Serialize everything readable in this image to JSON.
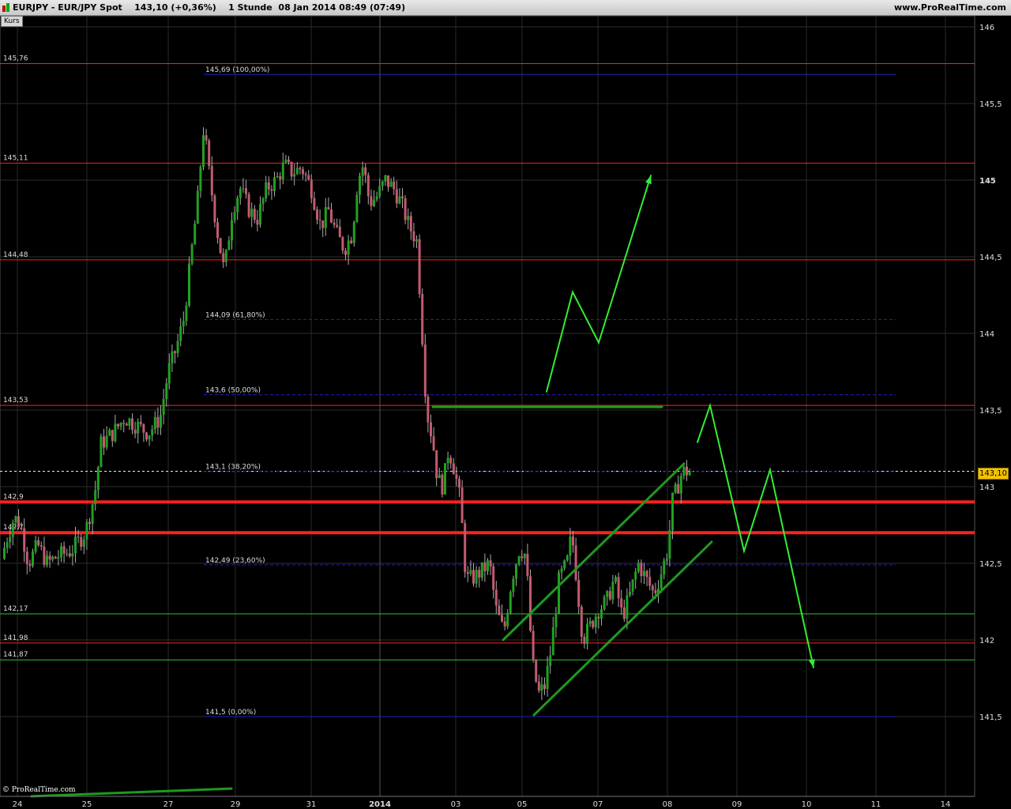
{
  "header": {
    "title": "EURJPY - EUR/JPY Spot    143,10 (+0,36%)    1 Stunde  08 Jan 2014 08:49 (07:49)",
    "site": "www.ProRealTime.com"
  },
  "panel": {
    "tab": "Kurs",
    "watermark": "© ProRealTime.com",
    "last_price": "143,10"
  },
  "colors": {
    "up": "#22a022",
    "down": "#c45a70",
    "wick": "#aaaaaa",
    "support": "#ff2020",
    "green_level": "#2cc52c",
    "fib": "#2020c0",
    "trend": "#1e9a1e",
    "forecast": "#33ee33"
  },
  "chart_data": {
    "type": "candlestick",
    "ylim": [
      141.0,
      146.05
    ],
    "y_ticks": [
      "146",
      "145,5",
      "145",
      "144,5",
      "144",
      "143,5",
      "143",
      "142,5",
      "142",
      "141,5"
    ],
    "x_ticks": [
      "24",
      "25",
      "27",
      "29",
      "31",
      "2014",
      "03",
      "05",
      "07",
      "08",
      "09",
      "10",
      "11",
      "14"
    ],
    "horizontal_levels": [
      {
        "label": "145,76",
        "value": 145.76,
        "style": "red-thin"
      },
      {
        "label": "145,11",
        "value": 145.11,
        "style": "red-thin"
      },
      {
        "label": "144,48",
        "value": 144.48,
        "style": "red-thin"
      },
      {
        "label": "143,53",
        "value": 143.53,
        "style": "red-thin"
      },
      {
        "label": "142,9",
        "value": 142.9,
        "style": "red-thick"
      },
      {
        "label": "142,7",
        "value": 142.7,
        "style": "red-thick"
      },
      {
        "label": "142,17",
        "value": 142.17,
        "style": "green-thin"
      },
      {
        "label": "141,98",
        "value": 141.98,
        "style": "red-thin"
      },
      {
        "label": "141,87",
        "value": 141.87,
        "style": "green-thin"
      }
    ],
    "fibonacci": [
      {
        "label": "145,69 (100,00%)",
        "value": 145.69
      },
      {
        "label": "144,09 (61,80%)",
        "value": 144.09
      },
      {
        "label": "143,6 (50,00%)",
        "value": 143.6
      },
      {
        "label": "143,1 (38,20%)",
        "value": 143.1
      },
      {
        "label": "142,49 (23,60%)",
        "value": 142.49
      },
      {
        "label": "141,5 (0,00%)",
        "value": 141.5
      }
    ],
    "last_price": 143.1,
    "price_path": [
      [
        0,
        142.45
      ],
      [
        10,
        142.65
      ],
      [
        20,
        142.8
      ],
      [
        28,
        142.75
      ],
      [
        38,
        142.5
      ],
      [
        50,
        142.62
      ],
      [
        62,
        142.5
      ],
      [
        76,
        142.55
      ],
      [
        92,
        142.58
      ],
      [
        110,
        142.7
      ],
      [
        122,
        142.95
      ],
      [
        130,
        143.28
      ],
      [
        145,
        143.35
      ],
      [
        160,
        143.45
      ],
      [
        175,
        143.4
      ],
      [
        190,
        143.35
      ],
      [
        205,
        143.45
      ],
      [
        215,
        143.75
      ],
      [
        225,
        143.9
      ],
      [
        235,
        144.1
      ],
      [
        245,
        144.55
      ],
      [
        252,
        144.85
      ],
      [
        260,
        145.35
      ],
      [
        268,
        145.0
      ],
      [
        276,
        144.7
      ],
      [
        286,
        144.4
      ],
      [
        296,
        144.8
      ],
      [
        306,
        144.95
      ],
      [
        318,
        144.8
      ],
      [
        328,
        144.75
      ],
      [
        340,
        144.95
      ],
      [
        352,
        145.0
      ],
      [
        362,
        145.1
      ],
      [
        372,
        145.05
      ],
      [
        384,
        145.08
      ],
      [
        396,
        144.95
      ],
      [
        408,
        144.7
      ],
      [
        418,
        144.8
      ],
      [
        428,
        144.65
      ],
      [
        438,
        144.55
      ],
      [
        448,
        144.65
      ],
      [
        455,
        145.0
      ],
      [
        462,
        145.1
      ],
      [
        470,
        144.85
      ],
      [
        480,
        144.9
      ],
      [
        490,
        145.0
      ],
      [
        500,
        144.95
      ],
      [
        510,
        144.85
      ],
      [
        520,
        144.7
      ],
      [
        530,
        144.6
      ],
      [
        536,
        144.05
      ],
      [
        542,
        143.5
      ],
      [
        550,
        143.3
      ],
      [
        556,
        143.05
      ],
      [
        563,
        143.0
      ],
      [
        570,
        143.25
      ],
      [
        578,
        143.1
      ],
      [
        585,
        142.9
      ],
      [
        592,
        142.4
      ],
      [
        600,
        142.4
      ],
      [
        612,
        142.45
      ],
      [
        622,
        142.5
      ],
      [
        630,
        142.2
      ],
      [
        640,
        142.05
      ],
      [
        650,
        142.4
      ],
      [
        660,
        142.6
      ],
      [
        668,
        142.55
      ],
      [
        676,
        141.85
      ],
      [
        684,
        141.65
      ],
      [
        692,
        141.7
      ],
      [
        700,
        141.95
      ],
      [
        710,
        142.4
      ],
      [
        720,
        142.5
      ],
      [
        726,
        142.7
      ],
      [
        733,
        142.35
      ],
      [
        740,
        142.0
      ],
      [
        750,
        142.1
      ],
      [
        760,
        142.2
      ],
      [
        770,
        142.25
      ],
      [
        780,
        142.4
      ],
      [
        790,
        142.15
      ],
      [
        800,
        142.3
      ],
      [
        810,
        142.5
      ],
      [
        820,
        142.4
      ],
      [
        830,
        142.3
      ],
      [
        840,
        142.45
      ],
      [
        848,
        142.6
      ],
      [
        853,
        142.9
      ],
      [
        860,
        143.0
      ],
      [
        866,
        143.1
      ],
      [
        872,
        143.1
      ]
    ],
    "drawings": [
      {
        "kind": "trend",
        "points": [
          [
            40,
            140.98
          ],
          [
            293,
            141.03
          ]
        ]
      },
      {
        "kind": "trend",
        "points": [
          [
            548,
            143.52
          ],
          [
            838,
            143.52
          ]
        ]
      },
      {
        "kind": "trend",
        "points": [
          [
            637,
            142.0
          ],
          [
            866,
            143.15
          ]
        ]
      },
      {
        "kind": "trend",
        "points": [
          [
            676,
            141.51
          ],
          [
            901,
            142.64
          ]
        ]
      },
      {
        "kind": "forecast",
        "points": [
          [
            692,
            143.62
          ],
          [
            725,
            144.27
          ],
          [
            758,
            143.94
          ],
          [
            824,
            145.03
          ]
        ],
        "arrow": true
      },
      {
        "kind": "forecast",
        "points": [
          [
            883,
            143.29
          ],
          [
            899,
            143.53
          ],
          [
            942,
            142.58
          ],
          [
            975,
            143.11
          ],
          [
            1030,
            141.82
          ]
        ],
        "arrow": true
      }
    ]
  }
}
